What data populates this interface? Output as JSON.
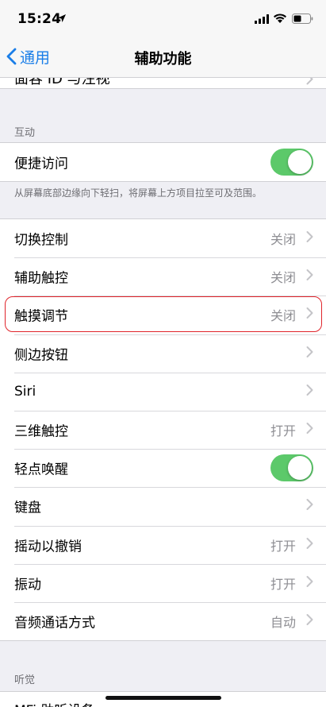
{
  "status_bar": {
    "time": "15:24",
    "icons": [
      "location-arrow-icon",
      "signal-icon",
      "wifi-icon",
      "battery-icon"
    ]
  },
  "nav": {
    "back_label": "通用",
    "title": "辅助功能"
  },
  "top_cut_row": {
    "label": "面容 ID 与注视"
  },
  "interaction_section": {
    "header": "互动",
    "reachability": {
      "label": "便捷访问",
      "toggle_on": true
    },
    "footnote": "从屏幕底部边缘向下轻扫，将屏幕上方项目拉至可及范围。"
  },
  "rows": [
    {
      "label": "切换控制",
      "value": "关闭"
    },
    {
      "label": "辅助触控",
      "value": "关闭"
    },
    {
      "label": "触摸调节",
      "value": "关闭"
    },
    {
      "label": "侧边按钮",
      "value": ""
    },
    {
      "label": "Siri",
      "value": ""
    },
    {
      "label": "三维触控",
      "value": "打开"
    },
    {
      "label": "轻点唤醒",
      "value": "",
      "toggle_on": true
    },
    {
      "label": "键盘",
      "value": ""
    },
    {
      "label": "摇动以撤销",
      "value": "打开"
    },
    {
      "label": "振动",
      "value": "打开"
    },
    {
      "label": "音频通话方式",
      "value": "自动"
    }
  ],
  "hearing_section": {
    "header": "听觉",
    "first_row": "MFi 助听设备"
  },
  "colors": {
    "accent": "#1a7ee8",
    "toggle_on": "#5cc96a",
    "highlight": "#e0242b",
    "background": "#efeff4"
  }
}
